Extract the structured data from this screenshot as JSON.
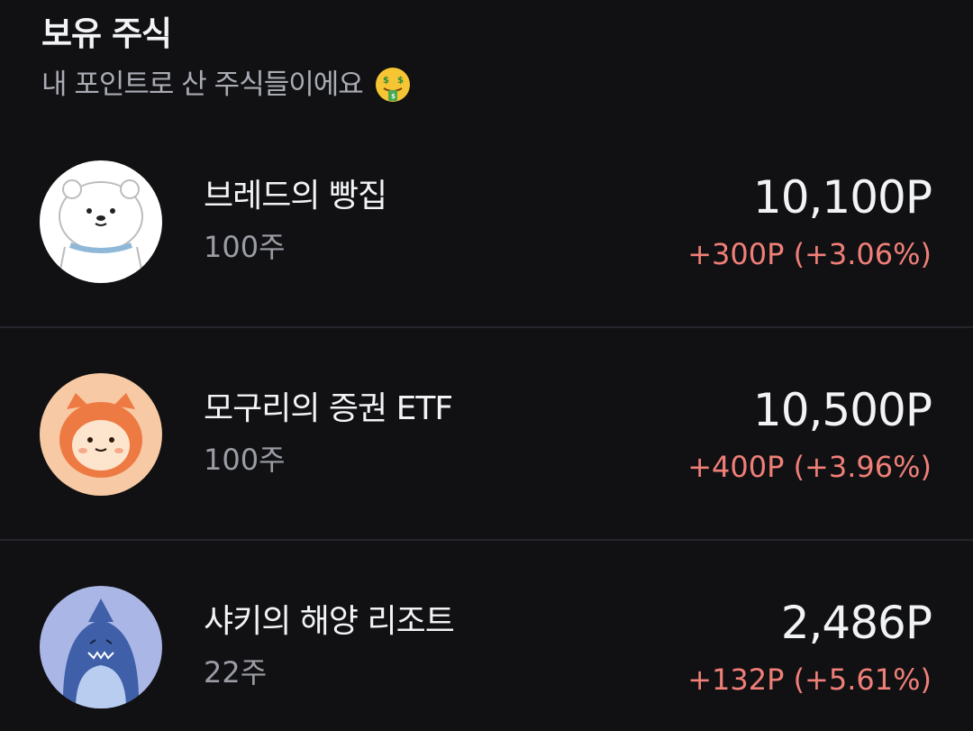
{
  "header": {
    "title": "보유 주식",
    "subtitle": "내 포인트로 산 주식들이에요",
    "subtitle_emoji": "money-mouth-face-icon"
  },
  "stocks": [
    {
      "name": "브레드의 빵집",
      "quantity": "100주",
      "price": "10,100P",
      "change": "+300P (+3.06%)",
      "avatar_icon": "polar-bear-icon",
      "avatar_bg": "#ffffff"
    },
    {
      "name": "모구리의 증권 ETF",
      "quantity": "100주",
      "price": "10,500P",
      "change": "+400P (+3.96%)",
      "avatar_icon": "orange-raccoon-icon",
      "avatar_bg": "#f7c9a4"
    },
    {
      "name": "샤키의 해양 리조트",
      "quantity": "22주",
      "price": "2,486P",
      "change": "+132P (+5.61%)",
      "avatar_icon": "blue-shark-icon",
      "avatar_bg": "#aab7e6"
    }
  ],
  "colors": {
    "background": "#111113",
    "text_primary": "#f2f3f5",
    "text_secondary": "#9a9da4",
    "gain": "#f07f78",
    "divider": "#24262b"
  }
}
